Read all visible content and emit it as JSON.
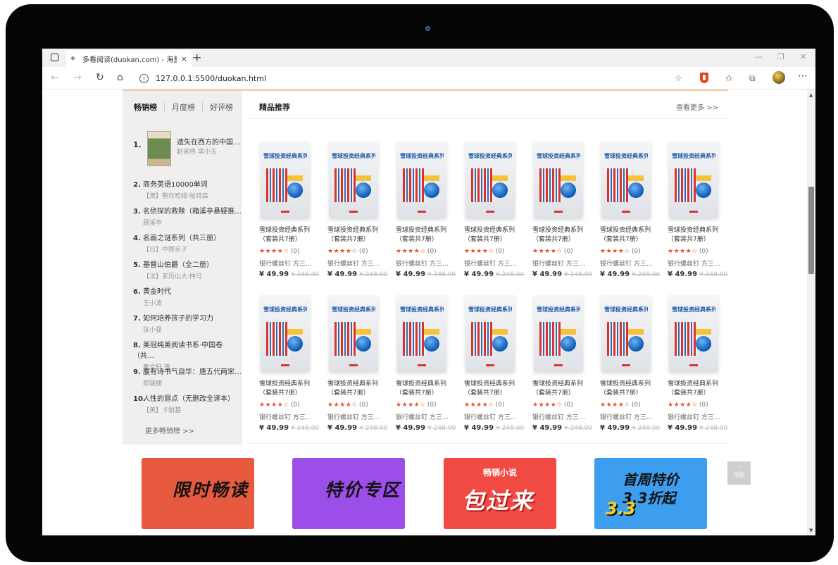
{
  "browser": {
    "tab_title": "多看阅读(duokan.com) - 海量畅…",
    "tab_close": "×",
    "new_tab": "+",
    "url": "127.0.0.1:5500/duokan.html",
    "window_controls": [
      "—",
      "❐",
      "✕"
    ]
  },
  "sidebar": {
    "tabs": [
      "畅销榜",
      "月度榜",
      "好评榜"
    ],
    "ranks": [
      {
        "num": "1.",
        "title": "遗失在西方的中国…",
        "author": "赵省伟 李小玉"
      },
      {
        "num": "2.",
        "title": "商务英语10000单词",
        "author": "【澳】熊坎哈姆·帕特森"
      },
      {
        "num": "3.",
        "title": "名侦探的救赎（箱溪亭悬疑推…",
        "author": "顾溪亭"
      },
      {
        "num": "4.",
        "title": "名画之谜系列（共三册）",
        "author": "【日】中野京子"
      },
      {
        "num": "5.",
        "title": "基督山伯爵（全二册）",
        "author": "【法】亚历山大·仲马"
      },
      {
        "num": "6.",
        "title": "黄金时代",
        "author": "王小波"
      },
      {
        "num": "7.",
        "title": "如何培养孩子的学习力",
        "author": "张小曼"
      },
      {
        "num": "8.",
        "title": "美冠纯美阅读书系·中国卷（共…",
        "author": "曹文轩 等"
      },
      {
        "num": "9.",
        "title": "腹有诗书气自华：唐五代两宋…",
        "author": "郑骏捷"
      },
      {
        "num": "10.",
        "title": "人性的弱点（无删改全译本）",
        "author": "【美】卡耐基"
      }
    ],
    "more": "更多畅销榜 >>"
  },
  "main": {
    "title": "精品推荐",
    "see_more": "查看更多 >>",
    "book": {
      "series": "雪球投资经典系列",
      "title": "雪球投资经典系列（套装共7册）",
      "stars": "★★★★☆",
      "count": "(0)",
      "author": "银行螺丝钉 方三…",
      "price": "¥ 49.99",
      "old_price": "¥ 248.00"
    }
  },
  "banners": [
    {
      "text": "限时畅读"
    },
    {
      "text": "特价专区"
    },
    {
      "small": "畅销小说",
      "text": "包过来"
    },
    {
      "text": "首周特价 3.3折起",
      "badge": "3.3"
    }
  ],
  "to_top": "顶部",
  "icons": [
    "tab-square-icon",
    "back-icon",
    "forward-icon",
    "refresh-icon",
    "home-icon",
    "info-icon",
    "favorites-add-icon",
    "shield-icon",
    "favorites-icon",
    "collections-icon",
    "profile-icon",
    "more-icon"
  ],
  "colors": {
    "accent": "#e9502b",
    "banner1": "#e85a3f",
    "banner2": "#9b4ee8",
    "banner3": "#f04a43",
    "banner4": "#3d9ef0"
  }
}
